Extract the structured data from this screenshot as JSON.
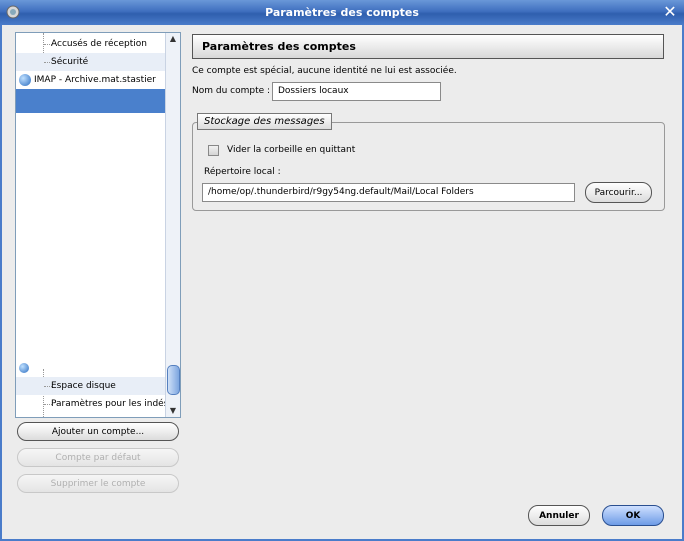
{
  "window": {
    "title": "Paramètres des comptes"
  },
  "tree": {
    "items": [
      {
        "label": "Accusés de réception",
        "level": 2
      },
      {
        "label": "Sécurité",
        "level": 2
      },
      {
        "label": "IMAP - Archive.mat.stastier",
        "level": 1
      },
      {
        "label": "Espace disque",
        "level": 2
      },
      {
        "label": "Paramètres pour les indés...",
        "level": 2
      }
    ]
  },
  "buttons": {
    "add_account": "Ajouter un compte...",
    "default_account": "Compte par défaut",
    "delete_account": "Supprimer le compte",
    "cancel": "Annuler",
    "ok": "OK",
    "browse": "Parcourir..."
  },
  "main": {
    "header": "Paramètres des comptes",
    "note": "Ce compte est spécial, aucune identité ne lui est associée.",
    "account_name_label": "Nom du compte :",
    "account_name_value": "Dossiers locaux",
    "storage_group_title": "Stockage des messages",
    "empty_trash_label": "Vider la corbeille en quittant",
    "local_dir_label": "Répertoire local :",
    "local_dir_value": "/home/op/.thunderbird/r9gy54ng.default/Mail/Local Folders"
  }
}
